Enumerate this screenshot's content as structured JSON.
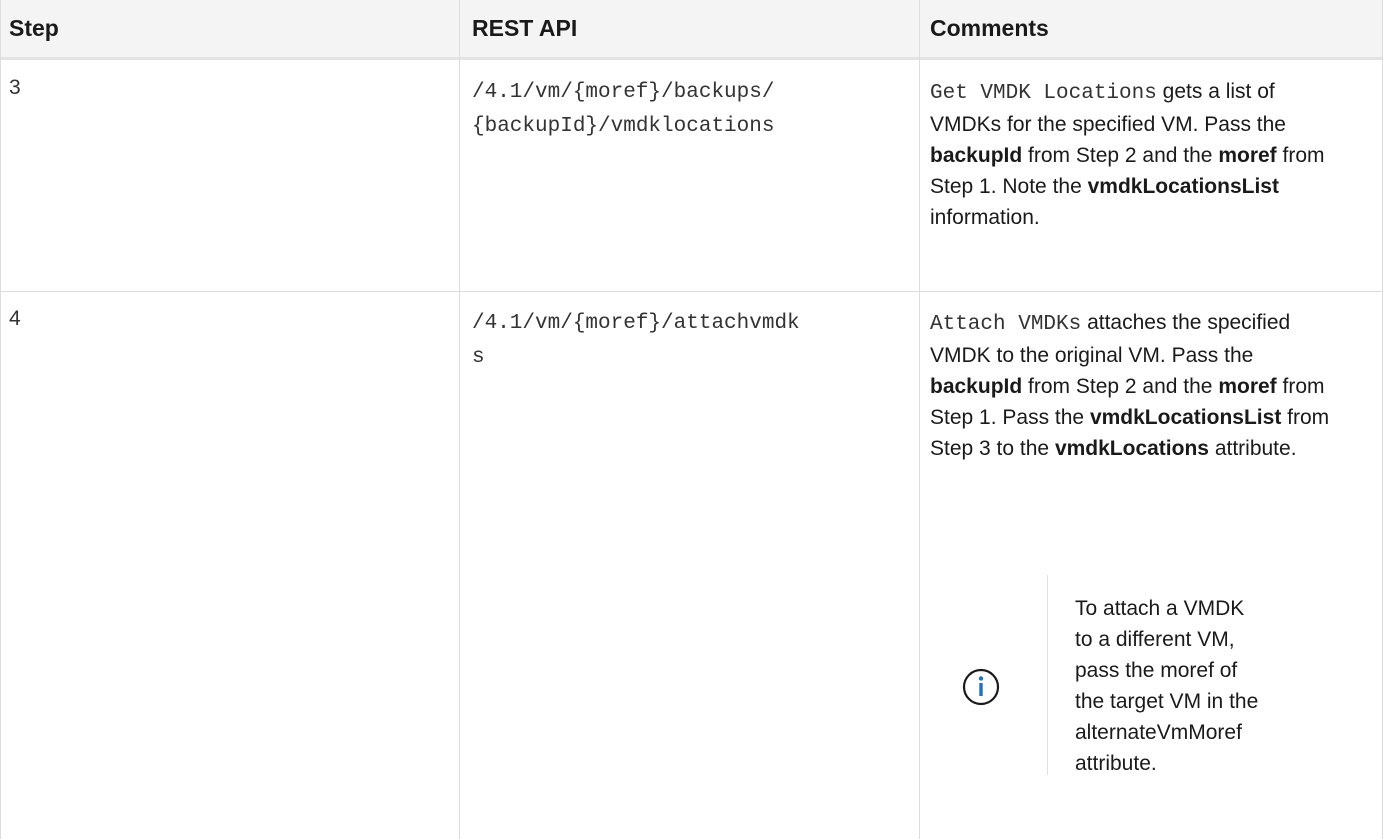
{
  "table": {
    "headers": [
      "Step",
      "REST API",
      "Comments"
    ],
    "rows": [
      {
        "step": "3",
        "api_line1": "/4.1/vm/{moref}/backups/",
        "api_line2": "{backupId}/vmdklocations",
        "comment": {
          "code": "Get VMDK Locations",
          "t1": " gets a list of VMDKs for the specified VM. Pass the ",
          "b1": "backupId",
          "t2": " from Step 2 and the ",
          "b2": "moref",
          "t3": " from Step 1. Note the ",
          "b3": "vmdkLocationsList",
          "t4": " information."
        }
      },
      {
        "step": "4",
        "api_line1": "/4.1/vm/{moref}/attachvmdk",
        "api_line2": "s",
        "comment": {
          "code": "Attach VMDKs",
          "t1": " attaches the specified VMDK to the original VM. Pass the ",
          "b1": "backupId",
          "t2": " from Step 2 and the ",
          "b2": "moref",
          "t3": " from Step 1. Pass the ",
          "b3": "vmdkLocationsList",
          "t4": " from Step 3 to the ",
          "b4": "vmdkLocations",
          "t5": " attribute."
        },
        "note": {
          "icon": "info-icon",
          "text": "To attach a VMDK to a different VM, pass the moref of the target VM in the alternateVmMoref attribute."
        }
      }
    ]
  },
  "colors": {
    "header_bg": "#f4f4f4",
    "icon": "#1a73c7",
    "grid": "#dcdcdc"
  }
}
